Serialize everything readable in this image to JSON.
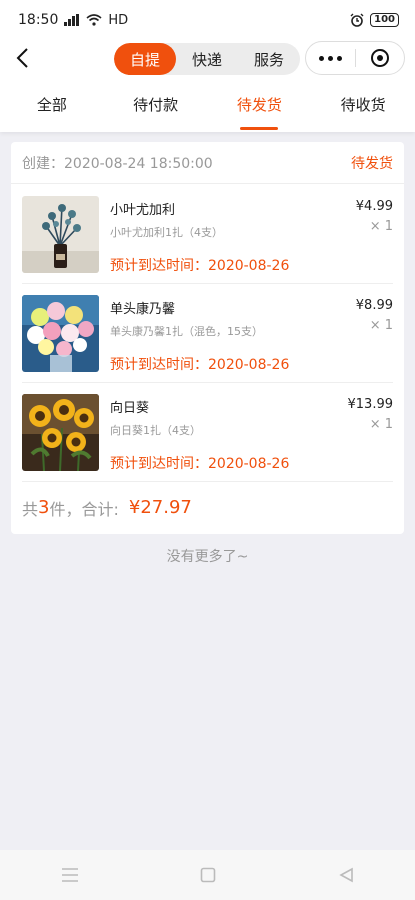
{
  "status_bar": {
    "time": "18:50",
    "network": "HD",
    "battery": "100"
  },
  "nav": {
    "segments": [
      "自提",
      "快递",
      "服务"
    ],
    "active_segment": 0
  },
  "tabs": [
    {
      "label": "全部"
    },
    {
      "label": "待付款"
    },
    {
      "label": "待发货"
    },
    {
      "label": "待收货"
    }
  ],
  "active_tab": 2,
  "order": {
    "created": "创建：2020-08-24 18:50:00",
    "status": "待发货",
    "items": [
      {
        "name": "小叶尤加利",
        "desc": "小叶尤加利1扎（4支）",
        "price": "¥4.99",
        "qty": "× 1",
        "eta": "预计到达时间：2020-08-26"
      },
      {
        "name": "单头康乃馨",
        "desc": "单头康乃馨1扎（混色，15支）",
        "price": "¥8.99",
        "qty": "× 1",
        "eta": "预计到达时间：2020-08-26"
      },
      {
        "name": "向日葵",
        "desc": "向日葵1扎（4支）",
        "price": "¥13.99",
        "qty": "× 1",
        "eta": "预计到达时间：2020-08-26"
      }
    ],
    "summary_prefix": "共 ",
    "count": "3",
    "summary_mid": "件，合计:",
    "total": "¥27.97"
  },
  "footer_text": "没有更多了~",
  "colors": {
    "accent": "#f0500d"
  },
  "icons": [
    "back-arrow-icon",
    "more-dots-icon",
    "target-icon",
    "signal-icon",
    "wifi-icon",
    "alarm-icon",
    "menu-icon",
    "home-square-icon",
    "back-triangle-icon"
  ]
}
